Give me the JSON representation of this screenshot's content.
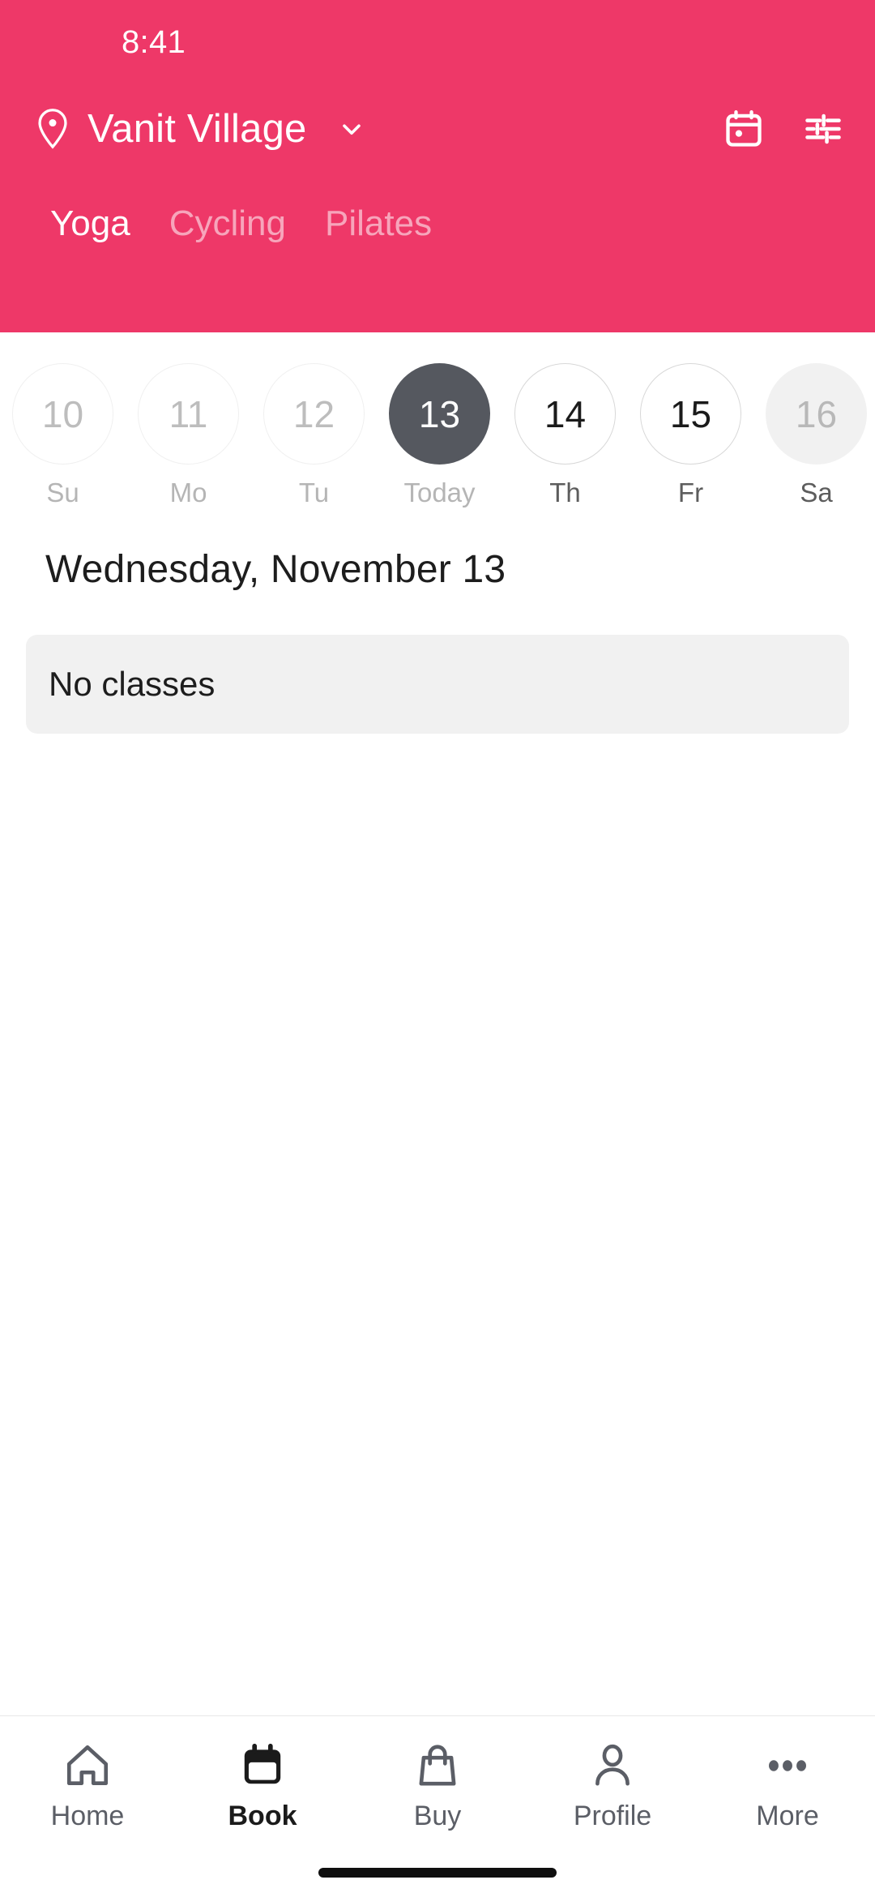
{
  "status_bar": {
    "time": "8:41"
  },
  "header": {
    "background_color": "#ee3868",
    "location_icon": "location-pin-icon",
    "location_name": "Vanit Village",
    "chevron_icon": "chevron-down-icon",
    "actions": [
      {
        "name": "calendar-icon",
        "label": "Calendar"
      },
      {
        "name": "filter-sliders-icon",
        "label": "Filters"
      }
    ],
    "tabs": [
      {
        "label": "Yoga",
        "active": true
      },
      {
        "label": "Cycling",
        "active": false
      },
      {
        "label": "Pilates",
        "active": false
      }
    ]
  },
  "date_strip": {
    "selected_color": "#55585f",
    "days": [
      {
        "date": "10",
        "label": "Su",
        "state": "past"
      },
      {
        "date": "11",
        "label": "Mo",
        "state": "past"
      },
      {
        "date": "12",
        "label": "Tu",
        "state": "past"
      },
      {
        "date": "13",
        "label": "Today",
        "state": "selected"
      },
      {
        "date": "14",
        "label": "Th",
        "state": "future"
      },
      {
        "date": "15",
        "label": "Fr",
        "state": "future"
      },
      {
        "date": "16",
        "label": "Sa",
        "state": "muted"
      }
    ]
  },
  "main": {
    "day_heading": "Wednesday, November 13",
    "empty_state": {
      "text": "No classes",
      "background_color": "#f1f1f1"
    }
  },
  "bottom_nav": {
    "items": [
      {
        "label": "Home",
        "icon": "home-icon",
        "active": false
      },
      {
        "label": "Book",
        "icon": "calendar-filled-icon",
        "active": true
      },
      {
        "label": "Buy",
        "icon": "shopping-bag-icon",
        "active": false
      },
      {
        "label": "Profile",
        "icon": "person-icon",
        "active": false
      },
      {
        "label": "More",
        "icon": "three-dots-icon",
        "active": false
      }
    ]
  }
}
